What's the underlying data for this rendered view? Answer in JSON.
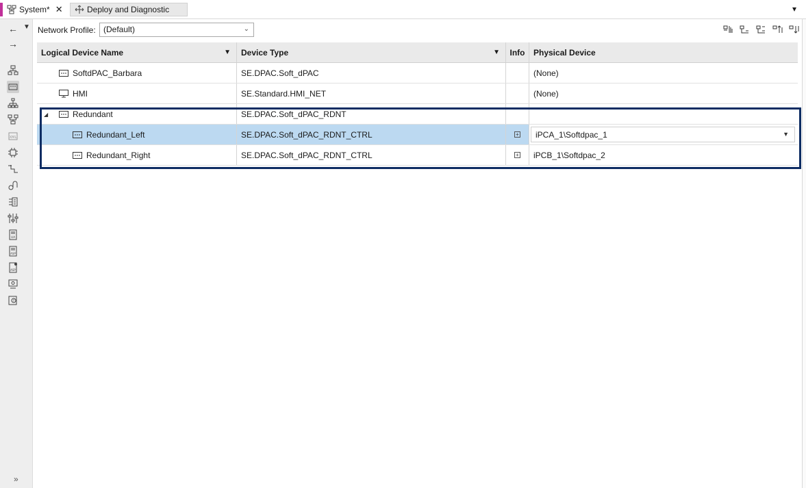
{
  "tabs": [
    {
      "label": "System*",
      "icon": "system-icon",
      "active": true
    },
    {
      "label": "Deploy and Diagnostic",
      "icon": "deploy-icon",
      "active": false
    }
  ],
  "toolbar": {
    "network_profile_label": "Network Profile:",
    "network_profile_value": "(Default)"
  },
  "grid": {
    "headers": {
      "name": "Logical Device Name",
      "type": "Device Type",
      "info": "Info",
      "physical": "Physical Device"
    },
    "rows": [
      {
        "name": "SoftdPAC_Barbara",
        "type": "SE.DPAC.Soft_dPAC",
        "physical": "(None)",
        "icon": "controller-icon",
        "level": 0
      },
      {
        "name": "HMI",
        "type": "SE.Standard.HMI_NET",
        "physical": "(None)",
        "icon": "monitor-icon",
        "level": 0
      },
      {
        "name": "Redundant",
        "type": "SE.DPAC.Soft_dPAC_RDNT",
        "physical": "",
        "icon": "controller-icon",
        "level": 0,
        "expanded": true
      },
      {
        "name": "Redundant_Left",
        "type": "SE.DPAC.Soft_dPAC_RDNT_CTRL",
        "physical": "iPCA_1\\Softdpac_1",
        "icon": "controller-icon",
        "level": 1,
        "selected": true
      },
      {
        "name": "Redundant_Right",
        "type": "SE.DPAC.Soft_dPAC_RDNT_CTRL",
        "physical": "iPCB_1\\Softdpac_2",
        "icon": "controller-icon",
        "level": 1
      }
    ]
  },
  "colors": {
    "selection": "#bcd9f1",
    "highlight_border": "#0d2c63",
    "tab_accent": "#c0309a"
  }
}
